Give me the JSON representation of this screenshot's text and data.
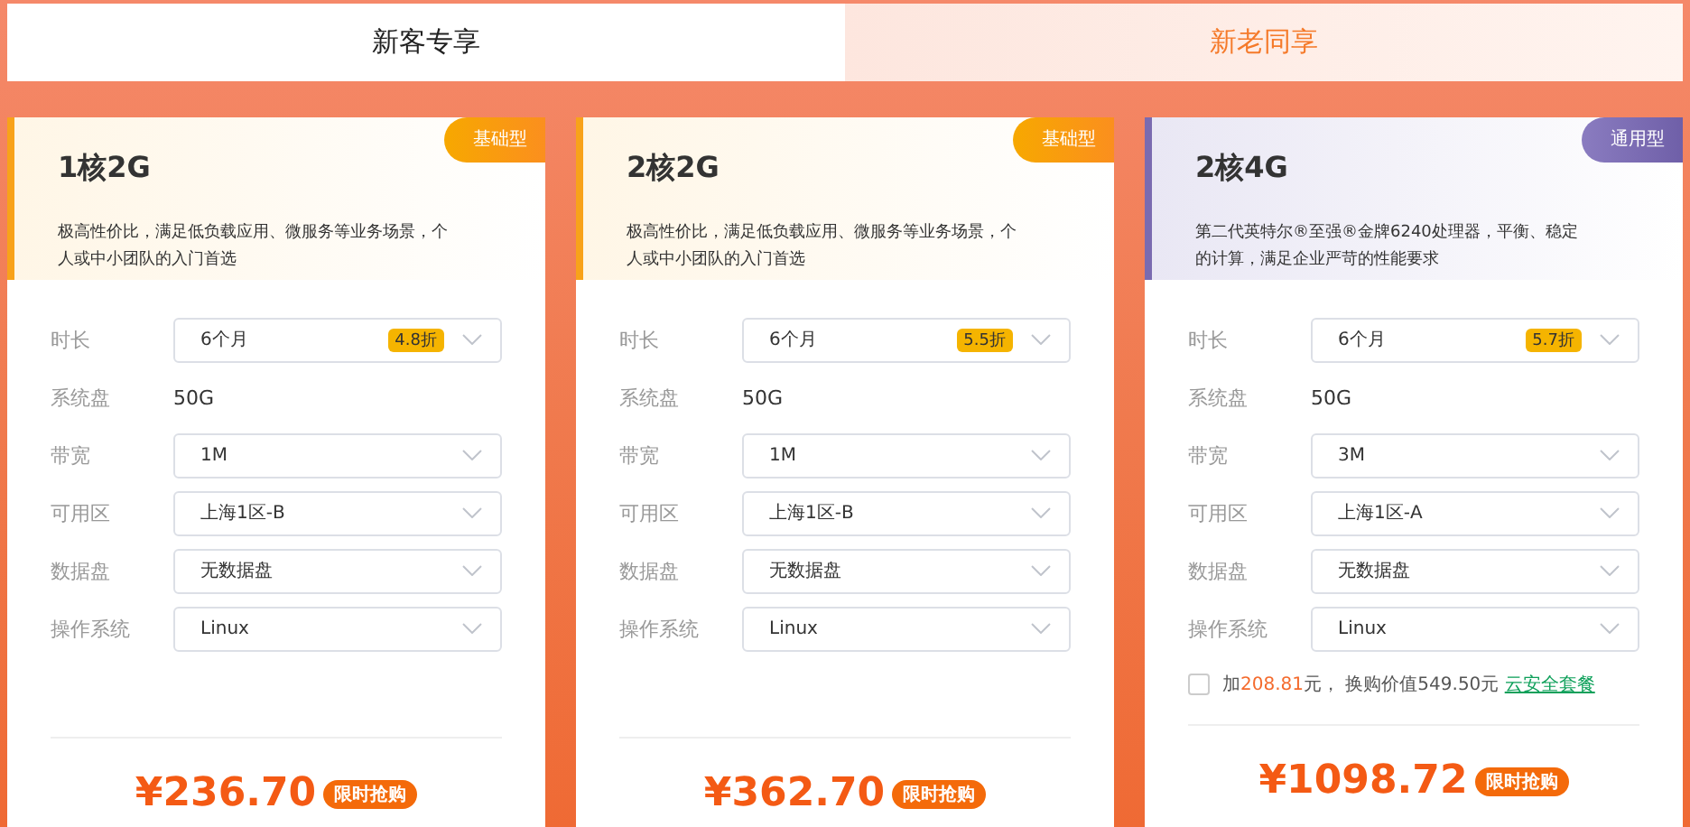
{
  "tabs": [
    {
      "label": "新客专享",
      "selected": true
    },
    {
      "label": "新老同享",
      "selected": false
    }
  ],
  "cards": [
    {
      "title": "1核2G",
      "badge": {
        "label": "基础型",
        "kind": "basic"
      },
      "description": "极高性价比，满足低负载应用、微服务等业务场景，个人或中小团队的入门首选",
      "fields": [
        {
          "label": "时长",
          "kind": "select",
          "value": "6个月",
          "discount": "4.8折"
        },
        {
          "label": "系统盘",
          "kind": "text",
          "value": "50G"
        },
        {
          "label": "带宽",
          "kind": "select",
          "value": "1M"
        },
        {
          "label": "可用区",
          "kind": "select",
          "value": "上海1区-B"
        },
        {
          "label": "数据盘",
          "kind": "select",
          "value": "无数据盘"
        },
        {
          "label": "操作系统",
          "kind": "select",
          "value": "Linux"
        }
      ],
      "price": "¥236.70",
      "price_tag": "限时抢购"
    },
    {
      "title": "2核2G",
      "badge": {
        "label": "基础型",
        "kind": "basic"
      },
      "description": "极高性价比，满足低负载应用、微服务等业务场景，个人或中小团队的入门首选",
      "fields": [
        {
          "label": "时长",
          "kind": "select",
          "value": "6个月",
          "discount": "5.5折"
        },
        {
          "label": "系统盘",
          "kind": "text",
          "value": "50G"
        },
        {
          "label": "带宽",
          "kind": "select",
          "value": "1M"
        },
        {
          "label": "可用区",
          "kind": "select",
          "value": "上海1区-B"
        },
        {
          "label": "数据盘",
          "kind": "select",
          "value": "无数据盘"
        },
        {
          "label": "操作系统",
          "kind": "select",
          "value": "Linux"
        }
      ],
      "price": "¥362.70",
      "price_tag": "限时抢购"
    },
    {
      "title": "2核4G",
      "badge": {
        "label": "通用型",
        "kind": "general"
      },
      "description": "第二代英特尔®至强®金牌6240处理器，平衡、稳定的计算，满足企业严苛的性能要求",
      "fields": [
        {
          "label": "时长",
          "kind": "select",
          "value": "6个月",
          "discount": "5.7折"
        },
        {
          "label": "系统盘",
          "kind": "text",
          "value": "50G"
        },
        {
          "label": "带宽",
          "kind": "select",
          "value": "3M"
        },
        {
          "label": "可用区",
          "kind": "select",
          "value": "上海1区-A"
        },
        {
          "label": "数据盘",
          "kind": "select",
          "value": "无数据盘"
        },
        {
          "label": "操作系统",
          "kind": "select",
          "value": "Linux"
        }
      ],
      "addon": {
        "checked": false,
        "prefix": "加",
        "amount": "208.81",
        "middle": "元， 换购价值549.50元",
        "link": "云安全套餐"
      },
      "price": "¥1098.72",
      "price_tag": "限时抢购"
    }
  ]
}
